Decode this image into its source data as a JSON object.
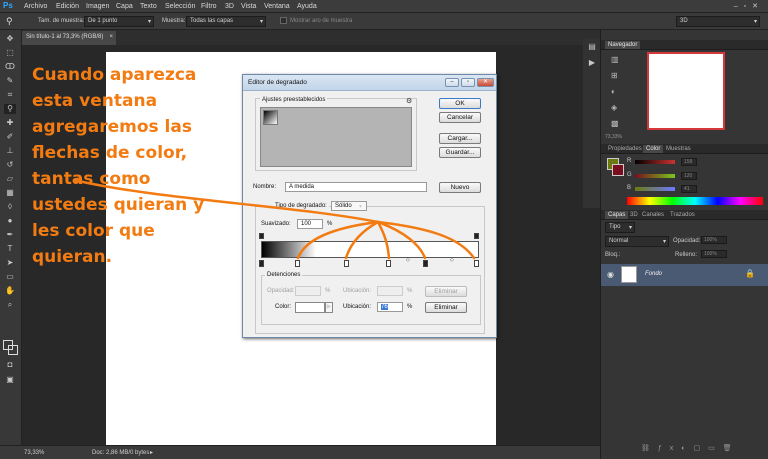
{
  "menubar": {
    "logo": "Ps",
    "items": [
      "Archivo",
      "Edición",
      "Imagen",
      "Capa",
      "Texto",
      "Selección",
      "Filtro",
      "3D",
      "Vista",
      "Ventana",
      "Ayuda"
    ]
  },
  "options": {
    "sample_size_label": "Tam. de muestra:",
    "sample_size_value": "De 1 punto",
    "sample_label": "Muestra:",
    "sample_value": "Todas las capas",
    "ring_label": "Mostrar aro de muestra",
    "workspace": "3D"
  },
  "doc_tab": {
    "title": "Sin título-1 al 73,3% (RGB/8)",
    "close": "×"
  },
  "status": {
    "zoom": "73,33%",
    "doc": "Doc: 2,86 MB/0 bytes"
  },
  "dialog": {
    "title": "Editor de degradado",
    "presets_label": "Ajustes preestablecidos",
    "ok": "OK",
    "cancel": "Cancelar",
    "load": "Cargar...",
    "save": "Guardar...",
    "name_label": "Nombre:",
    "name_value": "A medida",
    "new_button": "Nuevo",
    "type_label": "Tipo de degradado:",
    "type_value": "Sólido",
    "smooth_label": "Suavizado:",
    "smooth_value": "100",
    "percent": "%",
    "stops_label": "Detenciones",
    "opacity_label": "Opacidad:",
    "location_label": "Ubicación:",
    "delete": "Eliminar",
    "color_label": "Color:",
    "location_value": "76"
  },
  "annotation": {
    "lines": [
      "Cuando aparezca",
      "esta ventana",
      "agregaremos las",
      "flechas de color,",
      "tantas como",
      "ustedes quieran y",
      "les color que",
      "quieran."
    ]
  },
  "panels": {
    "navigator_tab": "Navegador",
    "navigator_zoom": "73,33%",
    "color_tabs": [
      "Propiedades",
      "Color",
      "Muestras"
    ],
    "channels": [
      {
        "name": "R",
        "value": "158"
      },
      {
        "name": "G",
        "value": "120"
      },
      {
        "name": "B",
        "value": "41"
      }
    ],
    "layer_tabs": [
      "Capas",
      "3D",
      "Canales",
      "Trazados"
    ],
    "kind_label": "Tipo",
    "blend_mode": "Normal",
    "opacity_label": "Opacidad:",
    "opacity_value": "100%",
    "lock_label": "Bloq.:",
    "fill_label": "Relleno:",
    "fill_value": "100%",
    "layer_name": "Fondo"
  },
  "colors": {
    "annotation": "#f27b12",
    "foreground": "#6b7a10",
    "background": "#7a0d1e",
    "layer_selected": "#4a5a73"
  }
}
